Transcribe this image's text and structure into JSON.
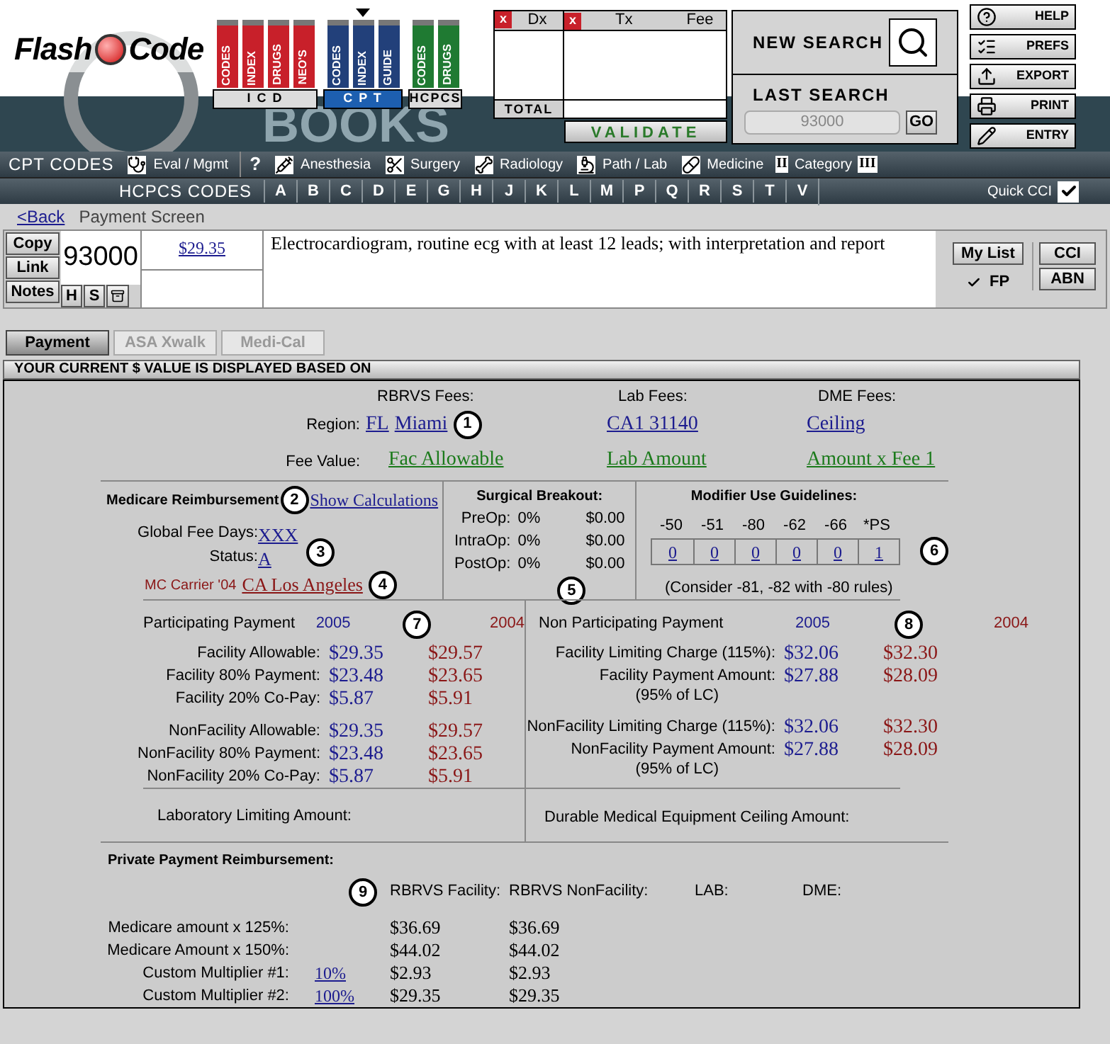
{
  "logo": {
    "first": "Flash",
    "second": "Code",
    "backdrop": "BOOKS"
  },
  "book_groups": [
    {
      "label": "I C D",
      "selected": false,
      "color": "#c8202a",
      "books": [
        "CODES",
        "INDEX",
        "DRUGS",
        "NEO'S"
      ]
    },
    {
      "label": "C P T",
      "selected": true,
      "color": "#22407a",
      "books": [
        "CODES",
        "INDEX",
        "GUIDE"
      ]
    },
    {
      "label": "HCPCS",
      "selected": false,
      "color": "#1f7a32",
      "books": [
        "CODES",
        "DRUGS"
      ]
    }
  ],
  "claim": {
    "remove": [
      "x",
      "x"
    ],
    "dx": "Dx",
    "tx": "Tx",
    "fee": "Fee",
    "total": "TOTAL",
    "validate": "VALIDATE"
  },
  "search": {
    "new_search": "NEW SEARCH",
    "last_search": "LAST SEARCH",
    "last_value": "93000",
    "go": "GO"
  },
  "tools": [
    "HELP",
    "PREFS",
    "EXPORT",
    "PRINT",
    "ENTRY"
  ],
  "cpt_bar": {
    "title": "CPT CODES",
    "items": [
      {
        "kind": "link",
        "label": "Eval / Mgmt"
      },
      {
        "kind": "glyph",
        "label": "?"
      },
      {
        "kind": "link",
        "label": "Anesthesia"
      },
      {
        "kind": "link",
        "label": "Surgery"
      },
      {
        "kind": "link",
        "label": "Radiology"
      },
      {
        "kind": "link",
        "label": "Path / Lab"
      },
      {
        "kind": "link",
        "label": "Medicine"
      },
      {
        "kind": "box",
        "label": "II"
      },
      {
        "kind": "text",
        "label": "Category"
      },
      {
        "kind": "box",
        "label": "III"
      }
    ]
  },
  "hcpcs_bar": {
    "title": "HCPCS CODES",
    "letters": [
      "A",
      "B",
      "C",
      "D",
      "E",
      "G",
      "H",
      "J",
      "K",
      "L",
      "M",
      "P",
      "Q",
      "R",
      "S",
      "T",
      "V"
    ],
    "quick_cci": {
      "label": "Quick CCI",
      "checked": true
    }
  },
  "nav": {
    "back": "<Back",
    "title": "Payment Screen"
  },
  "code": {
    "buttons": [
      "Copy",
      "Link",
      "Notes"
    ],
    "small_buttons": [
      "H",
      "S"
    ],
    "number": "93000",
    "fee": "$29.35",
    "description": "Electrocardiogram, routine ecg with at least 12 leads; with interpretation and report",
    "my_list": "My List",
    "fp": {
      "label": "FP",
      "checked": true
    },
    "side_buttons": [
      "CCI",
      "ABN"
    ]
  },
  "tabs": [
    {
      "label": "Payment",
      "selected": true
    },
    {
      "label": "ASA Xwalk",
      "selected": false
    },
    {
      "label": "Medi-Cal",
      "selected": false
    }
  ],
  "panel_title": "YOUR CURRENT $ VALUE IS DISPLAYED BASED ON",
  "fee_basis": {
    "headings": [
      "RBRVS Fees:",
      "Lab Fees:",
      "DME Fees:"
    ],
    "region_label": "Region:",
    "fee_value_label": "Fee Value:",
    "regions": [
      [
        "FL",
        "Miami"
      ],
      [
        "CA1 31140"
      ],
      [
        "Ceiling"
      ]
    ],
    "fee_values": [
      "Fac Allowable",
      "Lab Amount",
      "Amount x Fee 1"
    ],
    "callout": "1"
  },
  "medicare": {
    "title": "Medicare Reimbursement",
    "callout": "2",
    "show_calculations": "Show Calculations",
    "global_fee_days_label": "Global Fee Days:",
    "global_fee_days": "XXX",
    "status_label": "Status:",
    "status": "A",
    "status_callout": "3",
    "carrier_label": "MC Carrier '04",
    "carrier": "CA Los Angeles",
    "carrier_callout": "4"
  },
  "surgical": {
    "title": "Surgical Breakout:",
    "callout": "5",
    "rows": [
      {
        "label": "PreOp:",
        "percent": "0%",
        "amount": "$0.00"
      },
      {
        "label": "IntraOp:",
        "percent": "0%",
        "amount": "$0.00"
      },
      {
        "label": "PostOp:",
        "percent": "0%",
        "amount": "$0.00"
      }
    ]
  },
  "modifiers": {
    "title": "Modifier Use Guidelines:",
    "callout": "6",
    "items": [
      {
        "code": "-50",
        "value": "0"
      },
      {
        "code": "-51",
        "value": "0"
      },
      {
        "code": "-80",
        "value": "0"
      },
      {
        "code": "-62",
        "value": "0"
      },
      {
        "code": "-66",
        "value": "0"
      },
      {
        "code": "*PS",
        "value": "1"
      }
    ],
    "note": "(Consider -81, -82 with -80 rules)"
  },
  "participating": {
    "title": "Participating Payment",
    "years": [
      "2005",
      "2004"
    ],
    "callout": "7",
    "groups": [
      [
        {
          "label": "Facility Allowable:",
          "values": [
            "$29.35",
            "$29.57"
          ]
        },
        {
          "label": "Facility 80% Payment:",
          "values": [
            "$23.48",
            "$23.65"
          ]
        },
        {
          "label": "Facility 20% Co-Pay:",
          "values": [
            "$5.87",
            "$5.91"
          ]
        }
      ],
      [
        {
          "label": "NonFacility Allowable:",
          "values": [
            "$29.35",
            "$29.57"
          ]
        },
        {
          "label": "NonFacility 80% Payment:",
          "values": [
            "$23.48",
            "$23.65"
          ]
        },
        {
          "label": "NonFacility 20% Co-Pay:",
          "values": [
            "$5.87",
            "$5.91"
          ]
        }
      ]
    ]
  },
  "non_participating": {
    "title": "Non Participating Payment",
    "years": [
      "2005",
      "2004"
    ],
    "callout": "8",
    "groups": [
      [
        {
          "label": "Facility Limiting Charge (115%):",
          "values": [
            "$32.06",
            "$32.30"
          ]
        },
        {
          "label": "Facility Payment Amount:",
          "note": "(95% of LC)",
          "values": [
            "$27.88",
            "$28.09"
          ]
        }
      ],
      [
        {
          "label": "NonFacility Limiting Charge (115%):",
          "values": [
            "$32.06",
            "$32.30"
          ]
        },
        {
          "label": "NonFacility Payment Amount:",
          "note": "(95% of LC)",
          "values": [
            "$27.88",
            "$28.09"
          ]
        }
      ]
    ]
  },
  "limits": [
    "Laboratory Limiting Amount:",
    "Durable Medical Equipment Ceiling Amount:"
  ],
  "private": {
    "title": "Private Payment Reimbursement:",
    "callout": "9",
    "columns": [
      "RBRVS Facility:",
      "RBRVS NonFacility:",
      "LAB:",
      "DME:"
    ],
    "rows": [
      {
        "label": "Medicare amount x 125%:",
        "values": [
          "$36.69",
          "$36.69"
        ]
      },
      {
        "label": "Medicare Amount x 150%:",
        "values": [
          "$44.02",
          "$44.02"
        ]
      },
      {
        "label": "Custom Multiplier #1:",
        "multiplier": "10%",
        "values": [
          "$2.93",
          "$2.93"
        ]
      },
      {
        "label": "Custom Multiplier #2:",
        "multiplier": "100%",
        "values": [
          "$29.35",
          "$29.35"
        ]
      }
    ]
  }
}
